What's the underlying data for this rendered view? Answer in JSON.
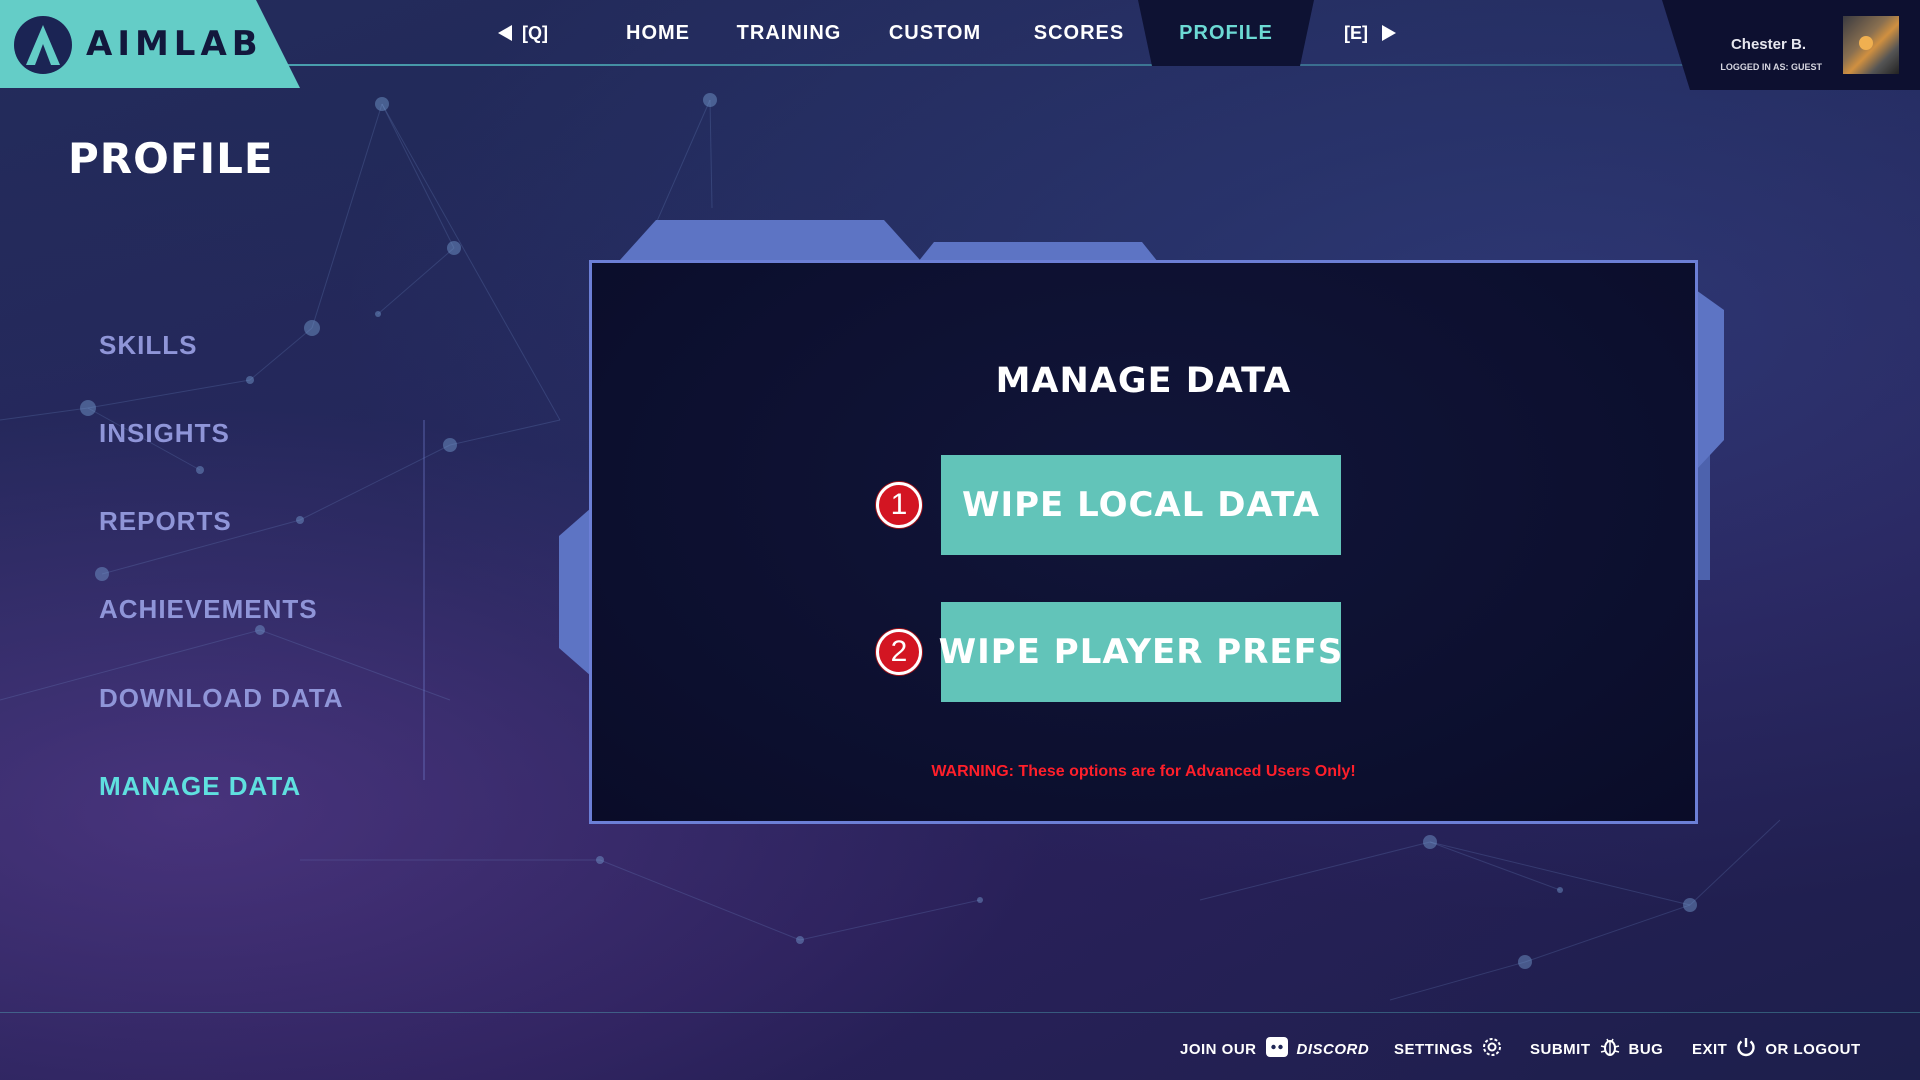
{
  "app": {
    "name": "AIMLAB"
  },
  "nav": {
    "prev_hint": "[Q]",
    "next_hint": "[E]",
    "items": [
      {
        "label": "HOME",
        "active": false
      },
      {
        "label": "TRAINING",
        "active": false
      },
      {
        "label": "CUSTOM",
        "active": false
      },
      {
        "label": "SCORES",
        "active": false
      },
      {
        "label": "PROFILE",
        "active": true
      }
    ]
  },
  "user": {
    "name": "Chester B.",
    "status": "LOGGED IN AS: GUEST"
  },
  "page": {
    "title": "PROFILE"
  },
  "sidebar": {
    "items": [
      {
        "label": "SKILLS",
        "active": false
      },
      {
        "label": "INSIGHTS",
        "active": false
      },
      {
        "label": "REPORTS",
        "active": false
      },
      {
        "label": "ACHIEVEMENTS",
        "active": false
      },
      {
        "label": "DOWNLOAD DATA",
        "active": false
      },
      {
        "label": "MANAGE DATA",
        "active": true
      }
    ]
  },
  "panel": {
    "title": "MANAGE DATA",
    "actions": [
      {
        "badge": "1",
        "label": "WIPE LOCAL DATA"
      },
      {
        "badge": "2",
        "label": "WIPE PLAYER PREFS"
      }
    ],
    "warning": "WARNING: These options are for Advanced Users Only!"
  },
  "footer": {
    "join_prefix": "JOIN OUR",
    "discord": "DISCORD",
    "settings": "SETTINGS",
    "submit": "SUBMIT",
    "bug": "BUG",
    "exit": "EXIT",
    "or_logout": "OR LOGOUT"
  },
  "colors": {
    "accent_teal": "#62c4b9",
    "nav_active": "#6cdad4",
    "sidebar_text": "#8f95d8",
    "sidebar_active": "#5fe0df",
    "warning": "#ff1f2a",
    "badge": "#d31522",
    "panel_border": "#6c7fd6"
  },
  "icons": {
    "logo": "aimlab-logo-icon",
    "prev": "triangle-left-icon",
    "next": "triangle-right-icon",
    "discord": "discord-icon",
    "settings": "gear-icon",
    "bug": "bug-icon",
    "exit": "power-icon"
  }
}
